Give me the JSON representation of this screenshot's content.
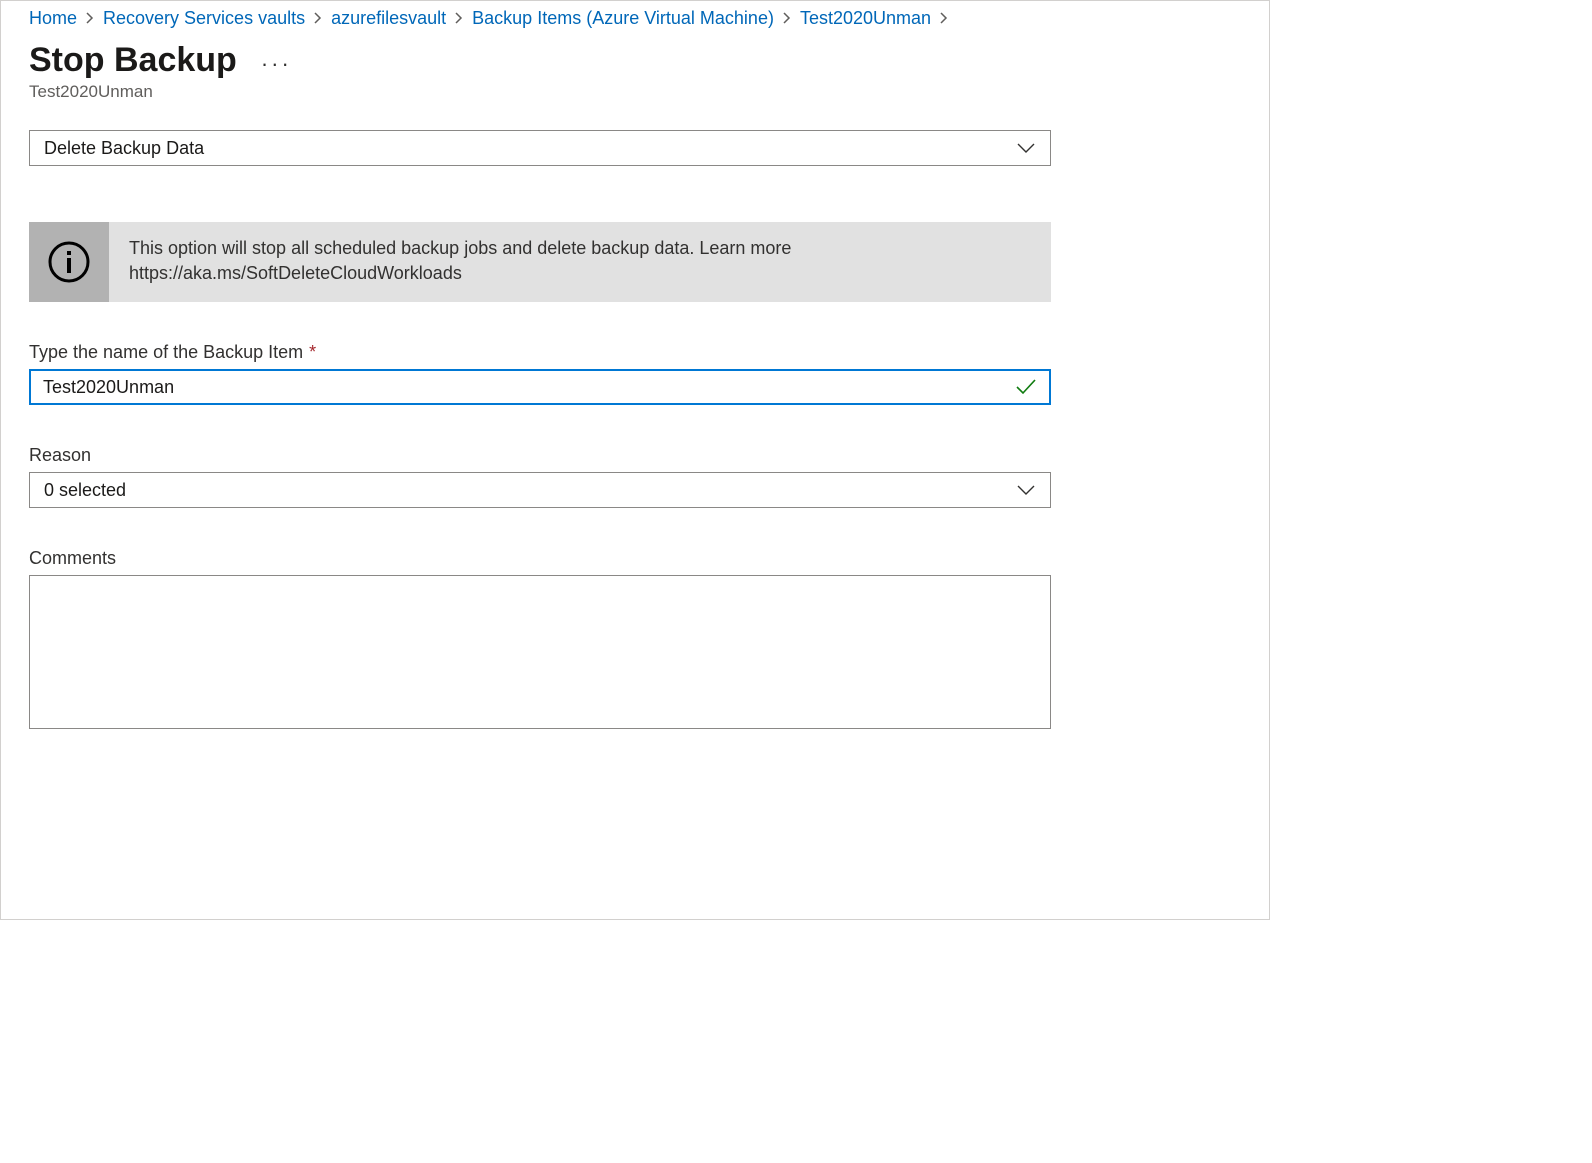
{
  "breadcrumb": {
    "items": [
      {
        "label": "Home"
      },
      {
        "label": "Recovery Services vaults"
      },
      {
        "label": "azurefilesvault"
      },
      {
        "label": "Backup Items (Azure Virtual Machine)"
      },
      {
        "label": "Test2020Unman"
      }
    ]
  },
  "header": {
    "title": "Stop Backup",
    "subtitle": "Test2020Unman"
  },
  "action_dropdown": {
    "selected": "Delete Backup Data"
  },
  "info_banner": {
    "line1": "This option will stop all scheduled backup jobs and delete backup data. Learn more",
    "line2": "https://aka.ms/SoftDeleteCloudWorkloads"
  },
  "fields": {
    "name": {
      "label": "Type the name of the Backup Item",
      "value": "Test2020Unman",
      "required": true,
      "valid": true
    },
    "reason": {
      "label": "Reason",
      "selected": "0 selected"
    },
    "comments": {
      "label": "Comments",
      "value": ""
    }
  }
}
